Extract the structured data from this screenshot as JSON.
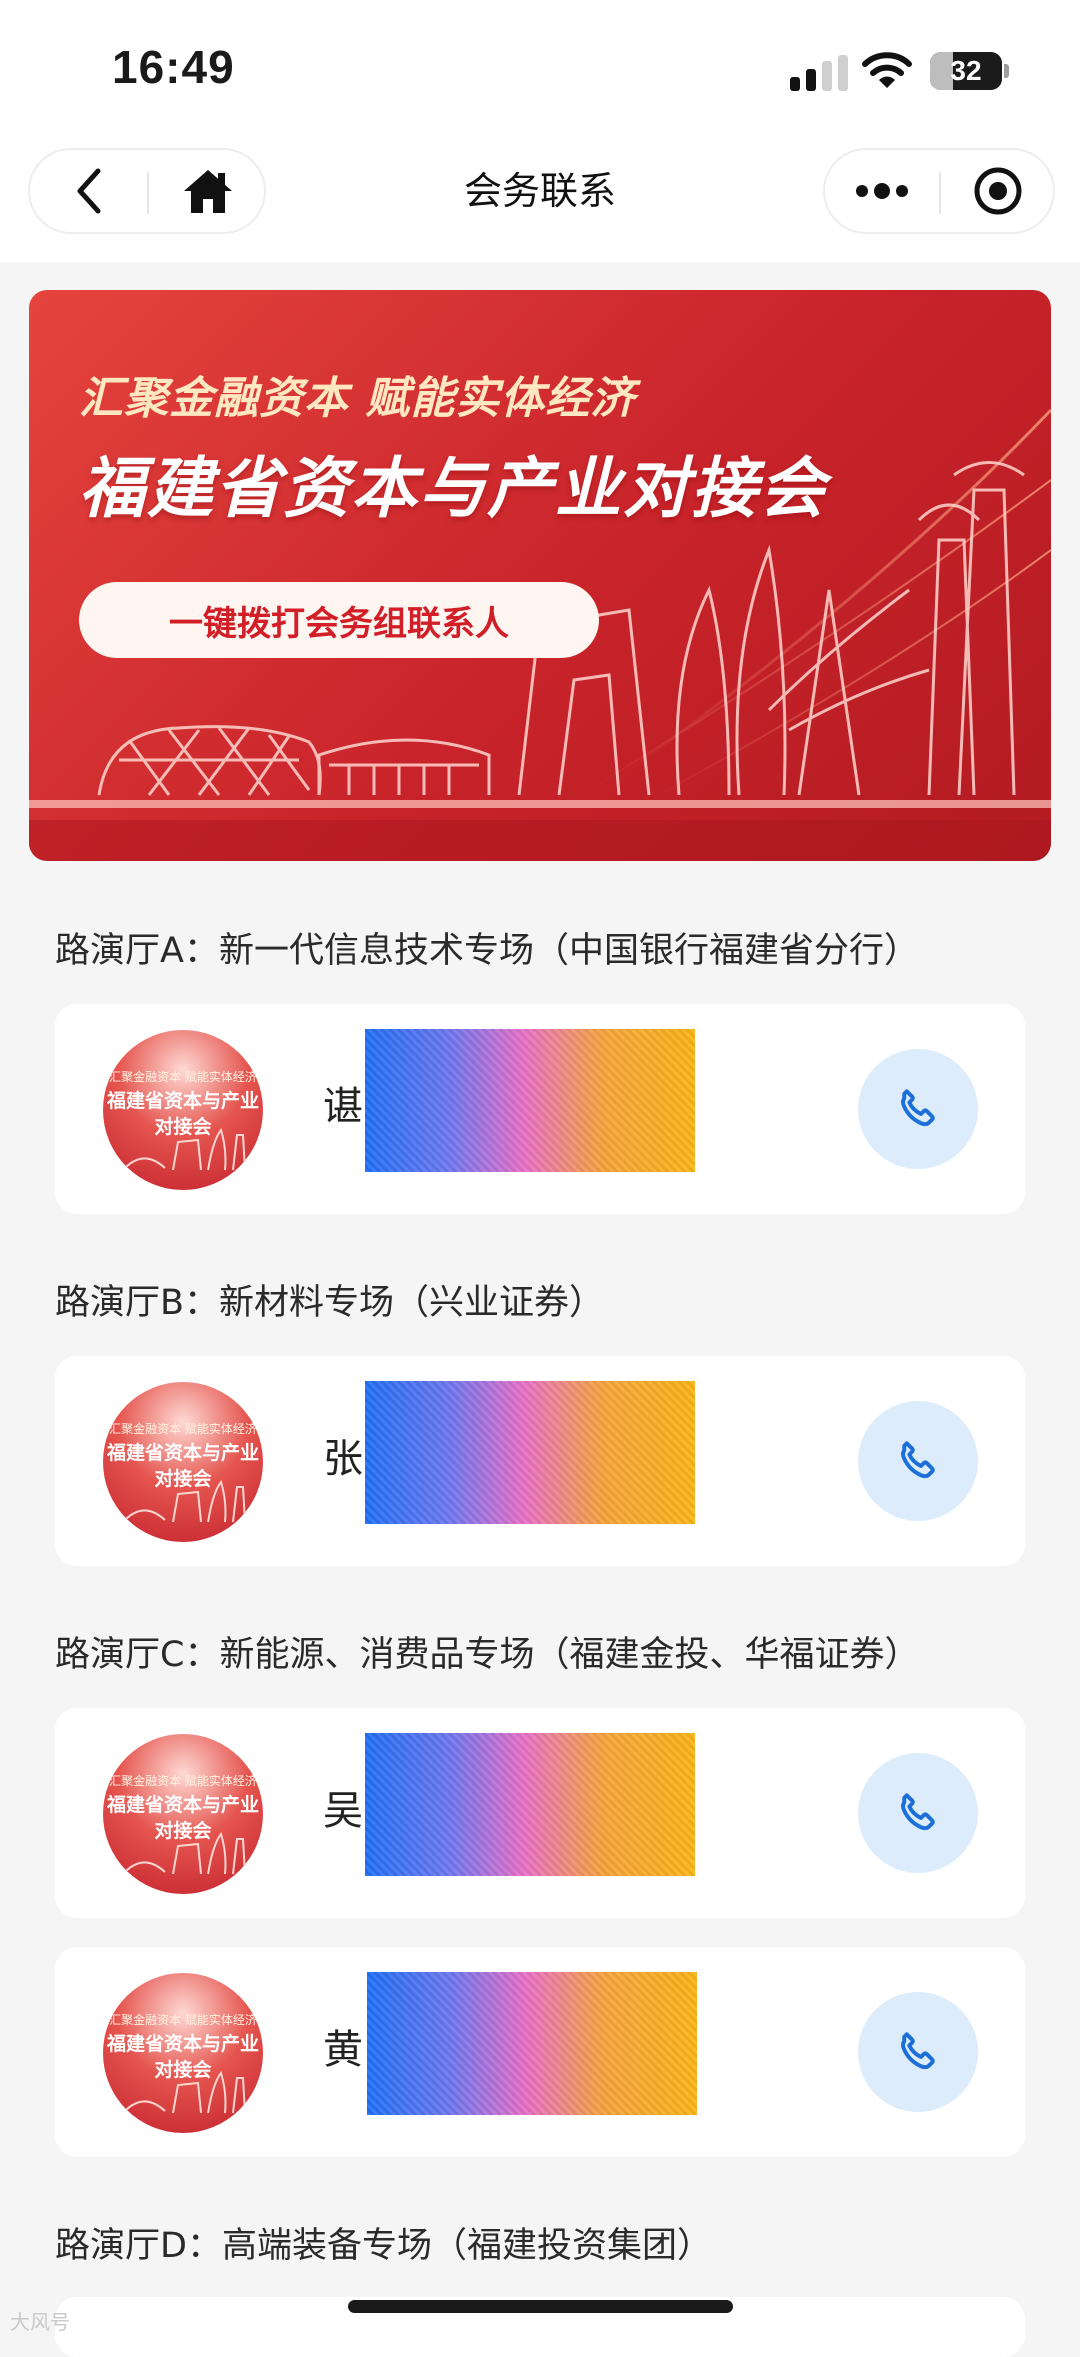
{
  "status_bar": {
    "time": "16:49",
    "battery": "32",
    "battery_level": 0.32,
    "icons": [
      "signal-icon",
      "wifi-icon",
      "battery-icon"
    ]
  },
  "nav": {
    "title": "会务联系",
    "icons": [
      "back-icon",
      "home-icon",
      "more-icon",
      "close-mini-program-icon"
    ]
  },
  "banner": {
    "slogan": "汇聚金融资本 赋能实体经济",
    "title": "福建省资本与产业对接会",
    "button": "一键拨打会务组联系人"
  },
  "avatar": {
    "line1": "汇聚金融资本 赋能实体经济",
    "line2": "福建省资本与产业",
    "line3": "对接会"
  },
  "sections": [
    {
      "title": "路演厅A：新一代信息技术专场（中国银行福建省分行）",
      "contacts": [
        {
          "name": "谌"
        }
      ]
    },
    {
      "title": "路演厅B：新材料专场（兴业证券）",
      "contacts": [
        {
          "name": "张"
        }
      ]
    },
    {
      "title": "路演厅C：新能源、消费品专场（福建金投、华福证券）",
      "contacts": [
        {
          "name": "吴"
        },
        {
          "name": "黄"
        }
      ]
    },
    {
      "title": "路演厅D：高端装备专场（福建投资集团）",
      "contacts": []
    }
  ],
  "watermark": "大风号"
}
